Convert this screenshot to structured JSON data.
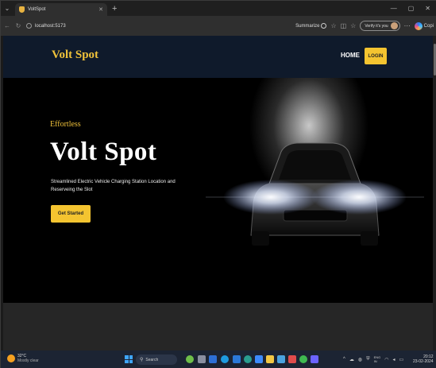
{
  "browser": {
    "tab_title": "VoltSpot",
    "url": "localhost:5173",
    "summarize_label": "Summarize",
    "verify_label": "Verify it's you",
    "copilot_label": "Copi"
  },
  "site": {
    "brand": "Volt Spot",
    "nav": {
      "home": "HOME",
      "login": "LOGIN"
    },
    "hero": {
      "eyebrow": "Effortless",
      "title": "Volt Spot",
      "description": "Streamlined Electric Vehicle Charging Station Location and Reserveing the Slot",
      "cta": "Get Started"
    }
  },
  "taskbar": {
    "weather_temp": "32°C",
    "weather_cond": "Mostly clear",
    "search_placeholder": "Search",
    "lang_top": "ENG",
    "lang_bottom": "IN",
    "time": "20:12",
    "date": "23-02-2024"
  },
  "colors": {
    "accent": "#f4c430",
    "nav_bg": "#0f1a2b",
    "hero_bg": "#000000"
  }
}
